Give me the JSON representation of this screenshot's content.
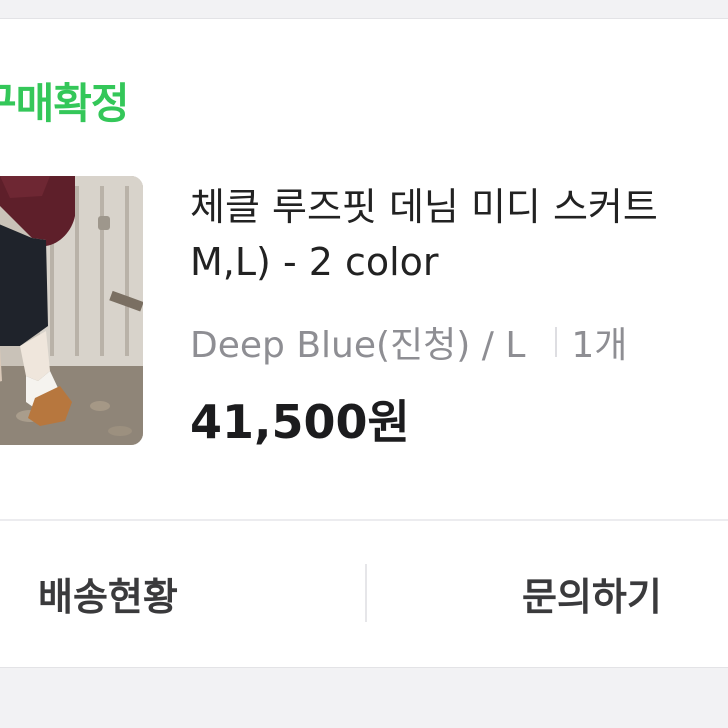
{
  "order": {
    "status_label": "구매확정",
    "product": {
      "title_line1": "체클 루즈핏 데님 미디 스커트",
      "title_line2": "M,L) - 2 color",
      "option": "Deep Blue(진청) / L",
      "quantity": "1개",
      "price": "41,500원"
    },
    "actions": {
      "shipping_label": "배송현황",
      "inquiry_label": "문의하기"
    }
  },
  "colors": {
    "status_green": "#34c759",
    "text_primary": "#222222",
    "text_secondary": "#8e8e93"
  }
}
